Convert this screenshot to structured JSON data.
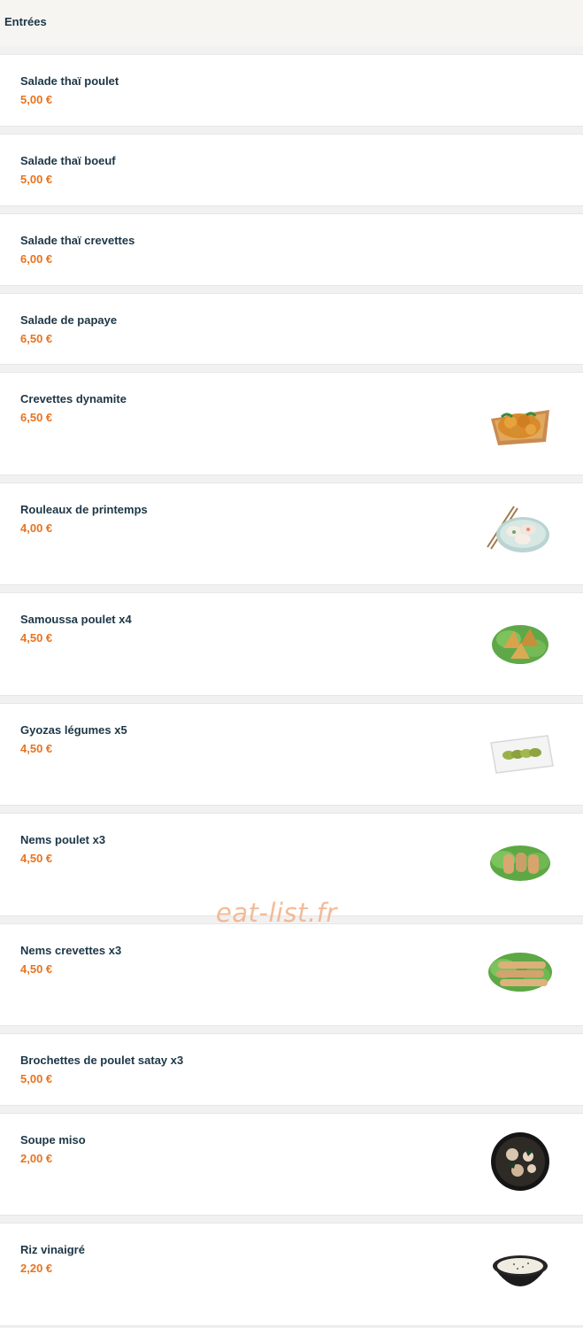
{
  "section": {
    "title": "Entrées"
  },
  "items": [
    {
      "name": "Salade thaï poulet",
      "price": "5,00 €",
      "icon": ""
    },
    {
      "name": "Salade thaï boeuf",
      "price": "5,00 €",
      "icon": ""
    },
    {
      "name": "Salade thaï crevettes",
      "price": "6,00 €",
      "icon": ""
    },
    {
      "name": "Salade de papaye",
      "price": "6,50 €",
      "icon": ""
    },
    {
      "name": "Crevettes dynamite",
      "price": "6,50 €",
      "icon": "dynamite-shrimp-photo"
    },
    {
      "name": "Rouleaux de printemps",
      "price": "4,00 €",
      "icon": "spring-rolls-photo"
    },
    {
      "name": "Samoussa poulet x4",
      "price": "4,50 €",
      "icon": "samosa-photo"
    },
    {
      "name": "Gyozas légumes x5",
      "price": "4,50 €",
      "icon": "gyoza-photo"
    },
    {
      "name": "Nems poulet x3",
      "price": "4,50 €",
      "icon": "nems-chicken-photo"
    },
    {
      "name": "Nems crevettes x3",
      "price": "4,50 €",
      "icon": "nems-shrimp-photo"
    },
    {
      "name": "Brochettes de poulet satay x3",
      "price": "5,00 €",
      "icon": ""
    },
    {
      "name": "Soupe miso",
      "price": "2,00 €",
      "icon": "miso-soup-photo"
    },
    {
      "name": "Riz vinaigré",
      "price": "2,20 €",
      "icon": "vinegared-rice-photo"
    }
  ],
  "watermark": "eat-list.fr",
  "colors": {
    "name": "#1c3647",
    "price": "#e8731f",
    "header_bg": "#f7f5f2",
    "watermark": "#f2b48d"
  }
}
